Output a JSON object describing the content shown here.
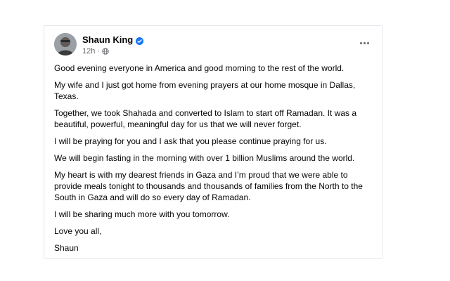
{
  "post": {
    "author": "Shaun King",
    "timestamp": "12h",
    "verified_color": "#1877f2",
    "more_icon": "more-horizontal-icon",
    "privacy_icon": "globe-icon",
    "paragraphs": [
      "Good evening everyone in America and good morning to the rest of the world.",
      "My wife and I just got home from evening prayers at our home mosque in Dallas, Texas.",
      "Together, we took Shahada and converted to Islam to start off Ramadan. It was a beautiful, powerful, meaningful day for us that we will never forget.",
      "I will be praying for you and I ask that you please continue praying for us.",
      "We will begin fasting in the morning with over 1 billion Muslims around the world.",
      "My heart is with my dearest friends in Gaza and I’m proud that we were able to provide meals tonight to thousands and thousands of families from the North to the South in Gaza and will do so every day of Ramadan.",
      "I will be sharing much more with you tomorrow.",
      "Love you all,",
      "Shaun"
    ]
  }
}
